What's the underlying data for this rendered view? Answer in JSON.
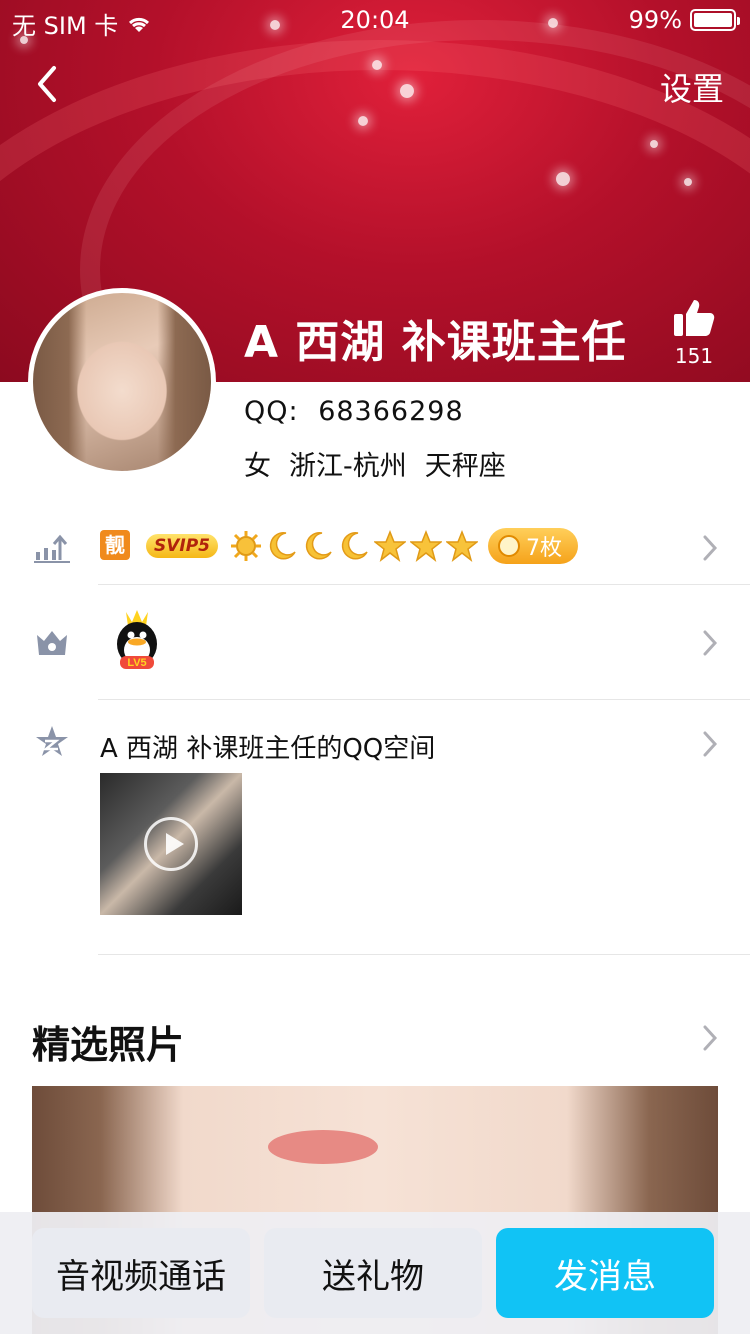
{
  "status_bar": {
    "carrier": "无 SIM 卡",
    "time": "20:04",
    "battery": "99%"
  },
  "nav": {
    "settings_label": "设置"
  },
  "profile": {
    "name": "A 西湖 补课班主任",
    "like_count": "151",
    "qq_label": "QQ:",
    "qq_number": "68366298",
    "gender": "女",
    "location": "浙江-杭州",
    "zodiac": "天秤座"
  },
  "badges": {
    "liang": "靓",
    "svip": "SVIP5",
    "level_icons": [
      "sun-icon",
      "moon-icon",
      "moon-icon",
      "moon-icon",
      "star-icon",
      "star-icon",
      "star-icon"
    ],
    "medal_count": "7枚"
  },
  "penguin_level": "LV5",
  "qzone": {
    "title": "A 西湖 补课班主任的QQ空间"
  },
  "featured": {
    "title": "精选照片"
  },
  "actions": {
    "call": "音视频通话",
    "gift": "送礼物",
    "message": "发消息"
  },
  "colors": {
    "header_red": "#b3102a",
    "accent_blue": "#11c3f5"
  }
}
